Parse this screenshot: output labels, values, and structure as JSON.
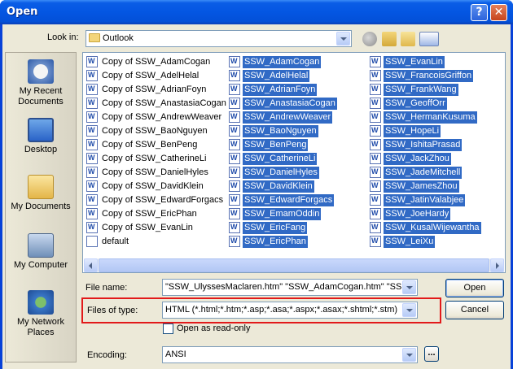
{
  "window": {
    "title": "Open"
  },
  "look_in": {
    "label": "Look in:",
    "value": "Outlook"
  },
  "places": [
    "My Recent Documents",
    "Desktop",
    "My Documents",
    "My Computer",
    "My Network Places"
  ],
  "files": {
    "col1": [
      {
        "name": "Copy of SSW_AdamCogan",
        "selected": false
      },
      {
        "name": "Copy of SSW_AdelHelal",
        "selected": false
      },
      {
        "name": "Copy of SSW_AdrianFoyn",
        "selected": false
      },
      {
        "name": "Copy of SSW_AnastasiaCogan",
        "selected": false
      },
      {
        "name": "Copy of SSW_AndrewWeaver",
        "selected": false
      },
      {
        "name": "Copy of SSW_BaoNguyen",
        "selected": false
      },
      {
        "name": "Copy of SSW_BenPeng",
        "selected": false
      },
      {
        "name": "Copy of SSW_CatherineLi",
        "selected": false
      },
      {
        "name": "Copy of SSW_DanielHyles",
        "selected": false
      },
      {
        "name": "Copy of SSW_DavidKlein",
        "selected": false
      },
      {
        "name": "Copy of SSW_EdwardForgacs",
        "selected": false
      },
      {
        "name": "Copy of SSW_EricPhan",
        "selected": false
      },
      {
        "name": "Copy of SSW_EvanLin",
        "selected": false
      },
      {
        "name": "default",
        "selected": false
      }
    ],
    "col2": [
      {
        "name": "SSW_AdamCogan",
        "selected": true
      },
      {
        "name": "SSW_AdelHelal",
        "selected": true
      },
      {
        "name": "SSW_AdrianFoyn",
        "selected": true
      },
      {
        "name": "SSW_AnastasiaCogan",
        "selected": true
      },
      {
        "name": "SSW_AndrewWeaver",
        "selected": true
      },
      {
        "name": "SSW_BaoNguyen",
        "selected": true
      },
      {
        "name": "SSW_BenPeng",
        "selected": true
      },
      {
        "name": "SSW_CatherineLi",
        "selected": true
      },
      {
        "name": "SSW_DanielHyles",
        "selected": true
      },
      {
        "name": "SSW_DavidKlein",
        "selected": true
      },
      {
        "name": "SSW_EdwardForgacs",
        "selected": true
      },
      {
        "name": "SSW_EmamOddin",
        "selected": true
      },
      {
        "name": "SSW_EricFang",
        "selected": true
      },
      {
        "name": "SSW_EricPhan",
        "selected": true
      }
    ],
    "col3": [
      {
        "name": "SSW_EvanLin",
        "selected": true
      },
      {
        "name": "SSW_FrancoisGriffon",
        "selected": true
      },
      {
        "name": "SSW_FrankWang",
        "selected": true
      },
      {
        "name": "SSW_GeoffOrr",
        "selected": true
      },
      {
        "name": "SSW_HermanKusuma",
        "selected": true
      },
      {
        "name": "SSW_HopeLi",
        "selected": true
      },
      {
        "name": "SSW_IshitaPrasad",
        "selected": true
      },
      {
        "name": "SSW_JackZhou",
        "selected": true
      },
      {
        "name": "SSW_JadeMitchell",
        "selected": true
      },
      {
        "name": "SSW_JamesZhou",
        "selected": true
      },
      {
        "name": "SSW_JatinValabjee",
        "selected": true
      },
      {
        "name": "SSW_JoeHardy",
        "selected": true
      },
      {
        "name": "SSW_KusalWijewantha",
        "selected": true
      },
      {
        "name": "SSW_LeiXu",
        "selected": true
      }
    ]
  },
  "file_name": {
    "label": "File name:",
    "value": "\"SSW_UlyssesMaclaren.htm\" \"SSW_AdamCogan.htm\" \"SS"
  },
  "files_of_type": {
    "label": "Files of type:",
    "value": "HTML (*.html;*.htm;*.asp;*.asa;*.aspx;*.asax;*.shtml;*.stm)"
  },
  "read_only": {
    "label": "Open as read-only",
    "checked": false
  },
  "encoding": {
    "label": "Encoding:",
    "value": "ANSI",
    "more_button": "..."
  },
  "buttons": {
    "open": "Open",
    "cancel": "Cancel"
  },
  "colors": {
    "title_bar": "#0456e2",
    "selection": "#316ac5",
    "highlight_box": "#e21a1a"
  }
}
